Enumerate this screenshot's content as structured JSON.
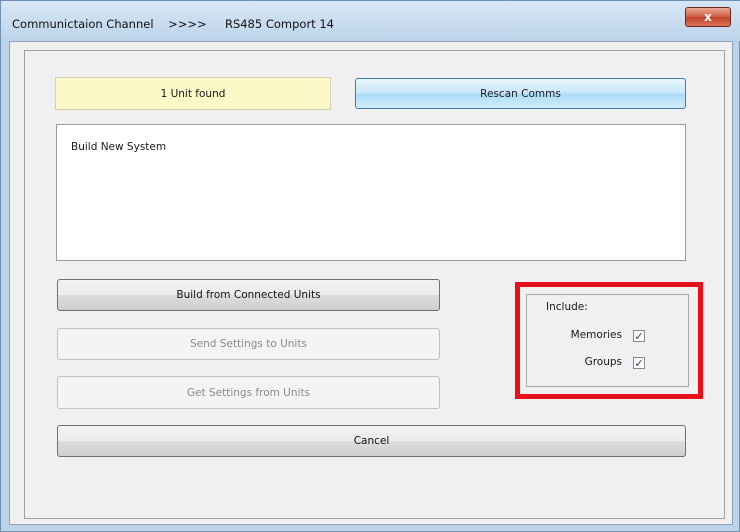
{
  "window": {
    "title": "Communictaion Channel    >>>>     RS485 Comport 14",
    "close_glyph": "x"
  },
  "status": {
    "units_found": "1 Unit found"
  },
  "buttons": {
    "rescan": "Rescan Comms",
    "build_from_connected": "Build from Connected Units",
    "send_settings": "Send Settings to Units",
    "get_settings": "Get Settings from Units",
    "cancel": "Cancel"
  },
  "system_list": {
    "text": "Build New System"
  },
  "include": {
    "label": "Include:",
    "options": [
      {
        "label": "Memories",
        "checked": true,
        "mark": "✓"
      },
      {
        "label": "Groups",
        "checked": true,
        "mark": "✓"
      }
    ]
  },
  "colors": {
    "highlight_border": "#e8101a",
    "status_background": "#fdf8c7",
    "rescan_button": "#bfe3f8"
  },
  "icons": {
    "close": "close-icon",
    "check": "checkmark-icon"
  }
}
